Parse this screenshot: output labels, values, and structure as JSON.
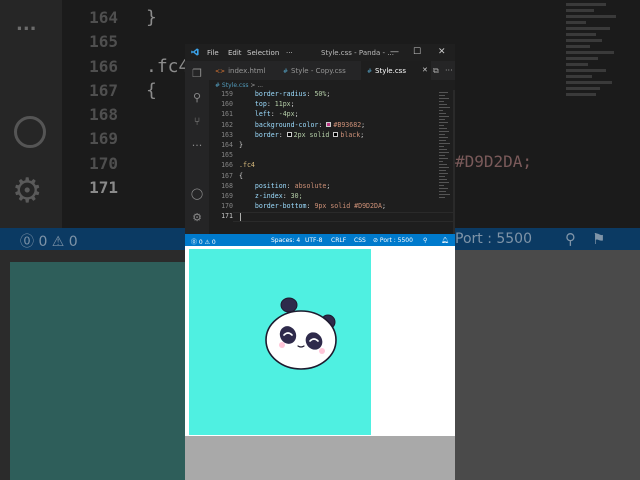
{
  "background": {
    "line_numbers": [
      "164",
      "165",
      "166",
      "167",
      "168",
      "169",
      "170",
      "171"
    ],
    "code_lines": [
      "}",
      "",
      ".fc4",
      "{",
      "",
      "",
      "",
      ""
    ],
    "right_code": "#D9D2DA;",
    "status_left": "⓪ 0 ⚠ 0",
    "status_port": "Port : 5500",
    "dots": "..."
  },
  "window": {
    "title": "Style.css - Panda - ...",
    "menu": [
      "File",
      "Edit",
      "Selection",
      "···"
    ],
    "controls": {
      "minimize": "—",
      "maximize": "☐",
      "close": "✕"
    }
  },
  "tabs": [
    {
      "label": "index.html",
      "icon": "<>",
      "active": false
    },
    {
      "label": "Style - Copy.css",
      "icon": "#",
      "active": false
    },
    {
      "label": "Style.css",
      "icon": "#",
      "active": true
    }
  ],
  "tab_actions": [
    "⧉",
    "···"
  ],
  "breadcrumb": {
    "file": "# Style.css",
    "sep": ">",
    "path": "..."
  },
  "editor": {
    "lines": [
      {
        "n": "159",
        "prop": "border-radius",
        "value": "50%",
        "kind": "num"
      },
      {
        "n": "160",
        "prop": "top",
        "value": "11px",
        "kind": "num"
      },
      {
        "n": "161",
        "prop": "left",
        "value": "-4px",
        "kind": "num"
      },
      {
        "n": "162",
        "prop": "background-color",
        "value": "#B93682",
        "kind": "color",
        "swatch": "#B93682"
      },
      {
        "n": "163",
        "prop": "border",
        "value": "2px solid",
        "extra": "black",
        "kind": "border",
        "swatch": "#000000"
      },
      {
        "n": "164",
        "text": "}"
      },
      {
        "n": "165",
        "text": ""
      },
      {
        "n": "166",
        "selector": ".fc4"
      },
      {
        "n": "167",
        "text": "{"
      },
      {
        "n": "168",
        "prop": "position",
        "value": "absolute",
        "kind": "str"
      },
      {
        "n": "169",
        "prop": "z-index",
        "value": "30;",
        "kind": "num"
      },
      {
        "n": "170",
        "prop": "border-bottom",
        "value": "9px solid #D9D2DA",
        "kind": "str"
      },
      {
        "n": "171",
        "text": ""
      }
    ]
  },
  "status": {
    "errors": "⓪ 0 ⚠ 0",
    "spaces": "Spaces: 4",
    "encoding": "UTF-8",
    "eol": "CRLF",
    "language": "CSS",
    "port": "⊘ Port : 5500"
  },
  "preview": {
    "stage_color": "#4FF0E1"
  }
}
